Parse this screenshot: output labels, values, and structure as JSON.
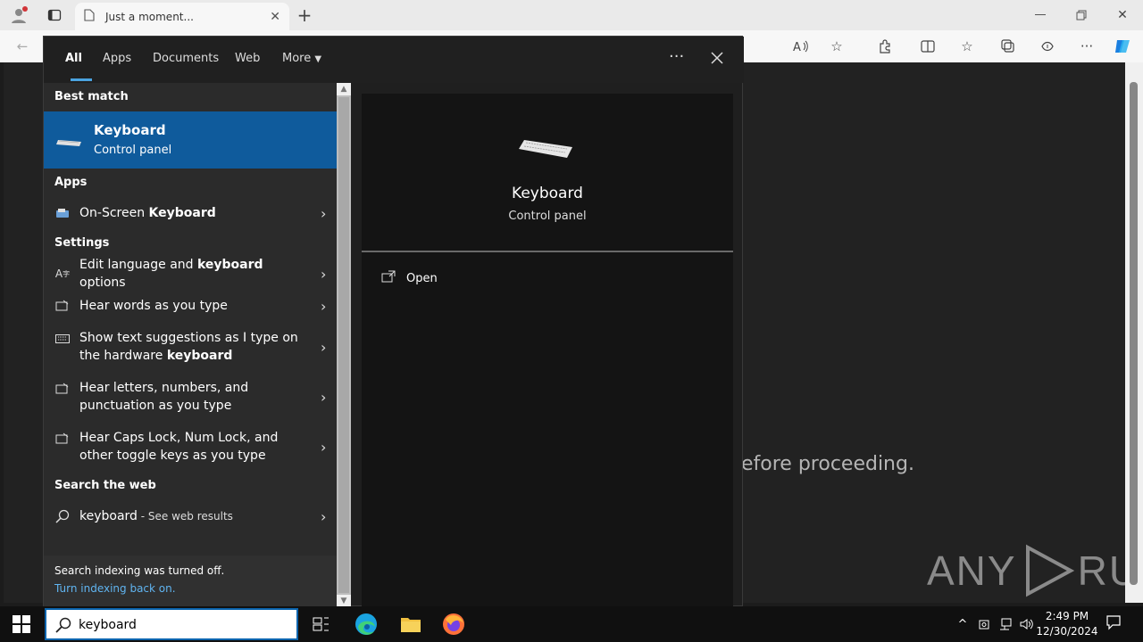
{
  "browser": {
    "tab_title": "Just a moment...",
    "icons": [
      "profile-icon",
      "tab-actions-icon",
      "page-icon",
      "close-tab-icon",
      "new-tab-icon",
      "minimize-icon",
      "restore-icon",
      "close-window-icon",
      "back-icon",
      "read-aloud-icon",
      "favorite-icon",
      "extensions-icon",
      "split-screen-icon",
      "favorites-icon",
      "collections-icon",
      "browser-essentials-icon",
      "more-icon",
      "copilot-icon"
    ]
  },
  "page": {
    "text": "efore proceeding.",
    "watermark_left": "ANY",
    "watermark_right": "RUN"
  },
  "search": {
    "tabs": [
      "All",
      "Apps",
      "Documents",
      "Web",
      "More"
    ],
    "active_tab": "All",
    "best_match_header": "Best match",
    "best_match": {
      "title": "Keyboard",
      "subtitle": "Control panel"
    },
    "apps_header": "Apps",
    "apps": [
      {
        "pre": "On-Screen ",
        "bold": "Keyboard",
        "post": ""
      }
    ],
    "settings_header": "Settings",
    "settings": [
      {
        "line1_pre": "Edit language and ",
        "line1_bold": "keyboard",
        "line1_post": " options",
        "line2_pre": "",
        "line2_bold": ""
      },
      {
        "line1_pre": "Hear words as you type",
        "line1_bold": "",
        "line1_post": "",
        "line2_pre": "",
        "line2_bold": ""
      },
      {
        "line1_pre": "Show text suggestions as I type on",
        "line1_bold": "",
        "line1_post": "",
        "line2_pre": "the hardware ",
        "line2_bold": "keyboard"
      },
      {
        "line1_pre": "Hear letters, numbers, and",
        "line1_bold": "",
        "line1_post": "",
        "line2_pre": "punctuation as you type",
        "line2_bold": ""
      },
      {
        "line1_pre": "Hear Caps Lock, Num Lock, and",
        "line1_bold": "",
        "line1_post": "",
        "line2_pre": "other toggle keys as you type",
        "line2_bold": ""
      }
    ],
    "web_header": "Search the web",
    "web": {
      "query": "keyboard",
      "suffix": " - See web results"
    },
    "indexing": {
      "line1": "Search indexing was turned off.",
      "link": "Turn indexing back on."
    },
    "preview": {
      "title": "Keyboard",
      "subtitle": "Control panel",
      "action": "Open"
    }
  },
  "taskbar": {
    "search_value": "keyboard",
    "time": "2:49 PM",
    "date": "12/30/2024"
  }
}
